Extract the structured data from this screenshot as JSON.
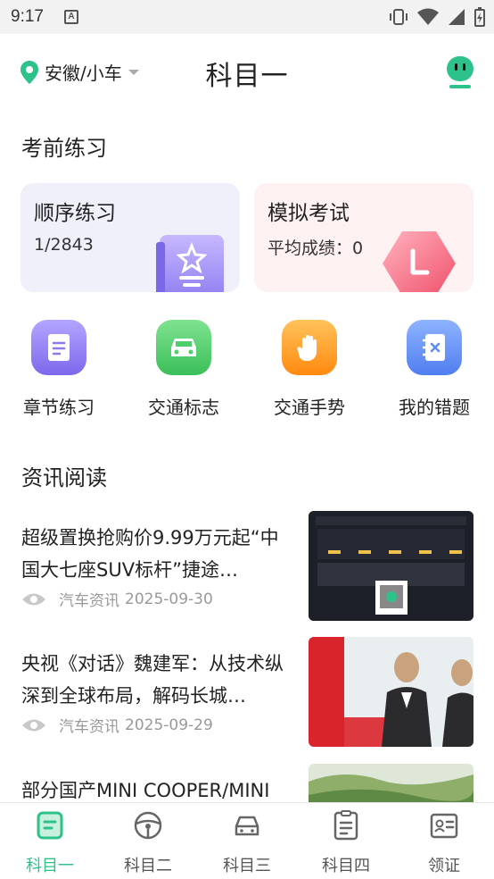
{
  "status_bar": {
    "time": "9:17"
  },
  "header": {
    "location": "安徽/小车",
    "title": "科目一"
  },
  "practice_section": {
    "title": "考前练习"
  },
  "cards": {
    "order": {
      "title": "顺序练习",
      "progress": "1/2843"
    },
    "exam": {
      "title": "模拟考试",
      "score_label": "平均成绩：0"
    }
  },
  "grid": [
    {
      "label": "章节练习",
      "icon": "chapter-icon",
      "color": "#8b7bf0"
    },
    {
      "label": "交通标志",
      "icon": "car-icon",
      "color": "#4fcf6b"
    },
    {
      "label": "交通手势",
      "icon": "hand-icon",
      "color": "#ff9a1f"
    },
    {
      "label": "我的错题",
      "icon": "notebook-icon",
      "color": "#5b8cf5"
    }
  ],
  "news_section": {
    "title": "资讯阅读"
  },
  "news": [
    {
      "title": "超级置换抢购价9.99万元起“中国大七座SUV标杆”捷途…",
      "source": "汽车资讯",
      "date": "2025-09-30"
    },
    {
      "title": "央视《对话》魏建军：从技术纵深到全球布局，解码长城…",
      "source": "汽车资讯",
      "date": "2025-09-29"
    },
    {
      "title": "部分国产MINI COOPER/MINI",
      "source": "",
      "date": ""
    }
  ],
  "bottom_nav": [
    {
      "label": "科目一",
      "icon": "subject-one-icon",
      "active": true
    },
    {
      "label": "科目二",
      "icon": "steering-wheel-icon",
      "active": false
    },
    {
      "label": "科目三",
      "icon": "car-front-icon",
      "active": false
    },
    {
      "label": "科目四",
      "icon": "document-icon",
      "active": false
    },
    {
      "label": "领证",
      "icon": "license-icon",
      "active": false
    }
  ],
  "colors": {
    "accent": "#2cc28a",
    "highlight": "#7ee0b8"
  }
}
